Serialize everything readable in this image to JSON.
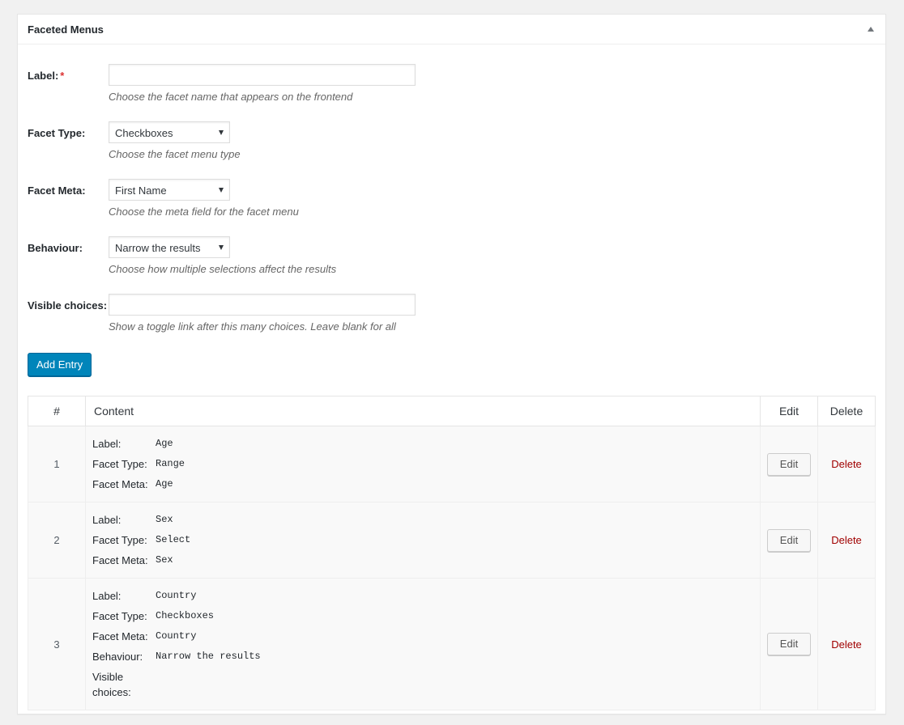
{
  "panel": {
    "title": "Faceted Menus"
  },
  "form": {
    "label": {
      "text": "Label:",
      "required_mark": "*",
      "value": "",
      "hint": "Choose the facet name that appears on the frontend"
    },
    "facet_type": {
      "text": "Facet Type:",
      "selected": "Checkboxes",
      "hint": "Choose the facet menu type"
    },
    "facet_meta": {
      "text": "Facet Meta:",
      "selected": "First Name",
      "hint": "Choose the meta field for the facet menu"
    },
    "behaviour": {
      "text": "Behaviour:",
      "selected": "Narrow the results",
      "hint": "Choose how multiple selections affect the results"
    },
    "visible_choices": {
      "text": "Visible choices:",
      "value": "",
      "hint": "Show a toggle link after this many choices. Leave blank for all"
    },
    "add_button": "Add Entry"
  },
  "table": {
    "headers": {
      "num": "#",
      "content": "Content",
      "edit": "Edit",
      "delete": "Delete"
    },
    "rows": [
      {
        "num": "1",
        "fields": [
          {
            "key": "Label:",
            "value": "Age"
          },
          {
            "key": "Facet Type:",
            "value": "Range"
          },
          {
            "key": "Facet Meta:",
            "value": "Age"
          }
        ],
        "edit": "Edit",
        "delete": "Delete"
      },
      {
        "num": "2",
        "fields": [
          {
            "key": "Label:",
            "value": "Sex"
          },
          {
            "key": "Facet Type:",
            "value": "Select"
          },
          {
            "key": "Facet Meta:",
            "value": "Sex"
          }
        ],
        "edit": "Edit",
        "delete": "Delete"
      },
      {
        "num": "3",
        "fields": [
          {
            "key": "Label:",
            "value": "Country"
          },
          {
            "key": "Facet Type:",
            "value": "Checkboxes"
          },
          {
            "key": "Facet Meta:",
            "value": "Country"
          },
          {
            "key": "Behaviour:",
            "value": "Narrow the results"
          },
          {
            "key": "Visible choices:",
            "value": ""
          }
        ],
        "edit": "Edit",
        "delete": "Delete"
      }
    ]
  }
}
